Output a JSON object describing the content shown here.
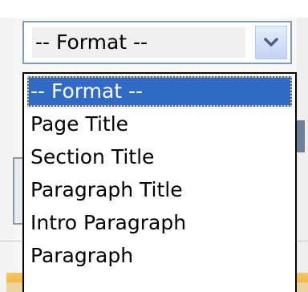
{
  "select": {
    "current_value": "-- Format --"
  },
  "dropdown": {
    "options": [
      {
        "label": "-- Format --",
        "selected": true
      },
      {
        "label": "Page Title",
        "selected": false
      },
      {
        "label": "Section Title",
        "selected": false
      },
      {
        "label": "Paragraph Title",
        "selected": false
      },
      {
        "label": "Intro Paragraph",
        "selected": false
      },
      {
        "label": "Paragraph",
        "selected": false
      }
    ]
  },
  "colors": {
    "highlight": "#316ac5",
    "focus_outline": "#f2c84b",
    "select_border": "#7f9db9",
    "arrow_bg": "#c3d3f5"
  },
  "icons": {
    "arrow": "chevron-down-icon"
  }
}
